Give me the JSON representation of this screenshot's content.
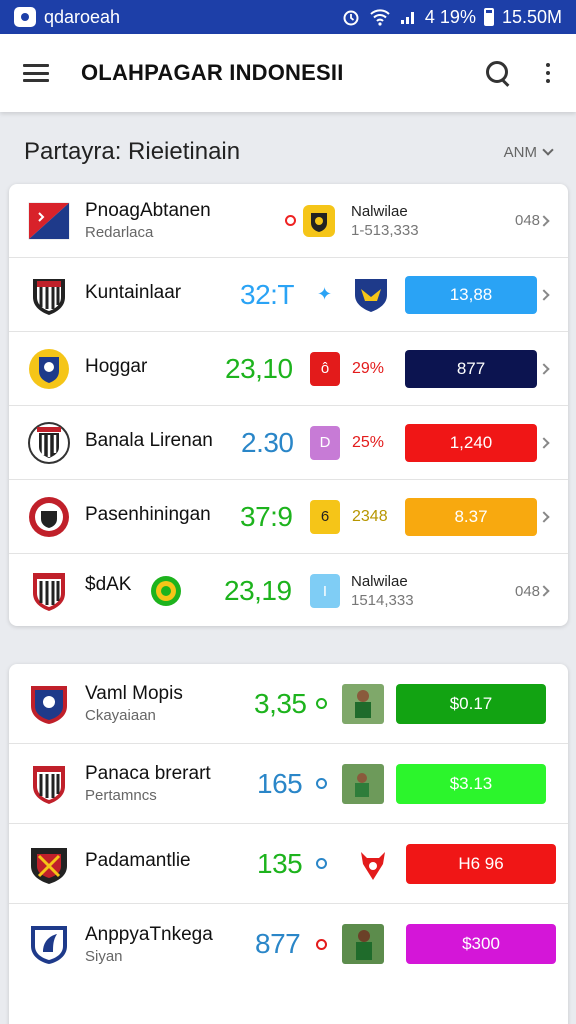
{
  "status_bar": {
    "app_name": "qdaroeah",
    "battery": "4 19%",
    "time": "15.50M"
  },
  "app_bar": {
    "title": "OLAHPAGAR INDONESII"
  },
  "section": {
    "title": "Partayra: Rieietinain",
    "filter": "ANM"
  },
  "colors": {
    "status_bar": "#1d3fa8",
    "accent_blue": "#2aa3f5",
    "accent_green": "#1db31d"
  },
  "list_top": [
    {
      "name": "PnoagAbtanen",
      "sub": "Redarlaca",
      "col2_title": "Nalwilae",
      "col2_sub": "1-513,333",
      "right": "048",
      "logo_icon": "flag-icon",
      "opp_icon": "shield-icon"
    },
    {
      "name": "Kuntainlaar",
      "score": "32:T",
      "pill": "13,88",
      "logo_icon": "crest-icon",
      "opp_icon": "eagle-shield-icon"
    },
    {
      "name": "Hoggar",
      "score": "23,10",
      "box": "ô",
      "mid": "29%",
      "pill": "877",
      "logo_icon": "lion-shield-icon"
    },
    {
      "name": "Banala Lirenan",
      "score": "2.30",
      "box": "D",
      "mid": "25%",
      "pill": "1,240",
      "logo_icon": "striped-crest-icon"
    },
    {
      "name": "Pasenhiningan",
      "score": "37:9",
      "box": "6",
      "mid": "2348",
      "pill": "8.37",
      "logo_icon": "round-crest-icon"
    },
    {
      "name": "$dAK",
      "score": "23,19",
      "box": "I",
      "col2_title": "Nalwilae",
      "col2_sub": "1514,333",
      "right": "048",
      "logo_icon": "striped-shield-icon",
      "badge_icon": "green-medal-icon"
    }
  ],
  "list_bottom": [
    {
      "name": "Vaml Mopis",
      "sub": "Ckayaiaan",
      "score": "3,35",
      "pill": "$0.17",
      "logo_icon": "blue-crest-icon",
      "photo_icon": "player-photo-icon"
    },
    {
      "name": "Panaca brerart",
      "sub": "Pertamncs",
      "score": "165",
      "pill": "$3.13",
      "logo_icon": "striped-crest-icon",
      "photo_icon": "player-photo-icon"
    },
    {
      "name": "Padamantlie",
      "score": "135",
      "pill": "H6 96",
      "logo_icon": "star-crest-icon",
      "opp_icon": "red-bull-icon"
    },
    {
      "name": "AnppyaTnkega",
      "sub": "Siyan",
      "score": "877",
      "pill": "$300",
      "logo_icon": "knight-crest-icon",
      "photo_icon": "player-photo-icon"
    }
  ]
}
